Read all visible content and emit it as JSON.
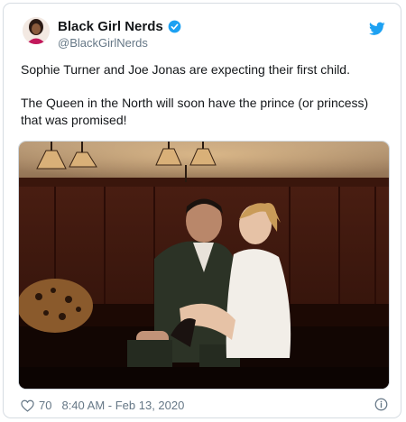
{
  "tweet": {
    "author_name": "Black Girl Nerds",
    "author_handle": "@BlackGirlNerds",
    "verified": true,
    "paragraphs": [
      "Sophie Turner and Joe Jonas are expecting their first child.",
      "The Queen in the North will soon have the prince (or princess) that was promised!"
    ],
    "likes": "70",
    "timestamp": "8:40 AM - Feb 13, 2020"
  },
  "icons": {
    "avatar": "avatar",
    "verified": "verified-badge-icon",
    "brand": "twitter-bird-icon",
    "like": "heart-icon",
    "info": "info-icon"
  },
  "colors": {
    "brand_blue": "#1da1f2",
    "text": "#14171a",
    "muted": "#657786",
    "border": "#d6dce2"
  }
}
